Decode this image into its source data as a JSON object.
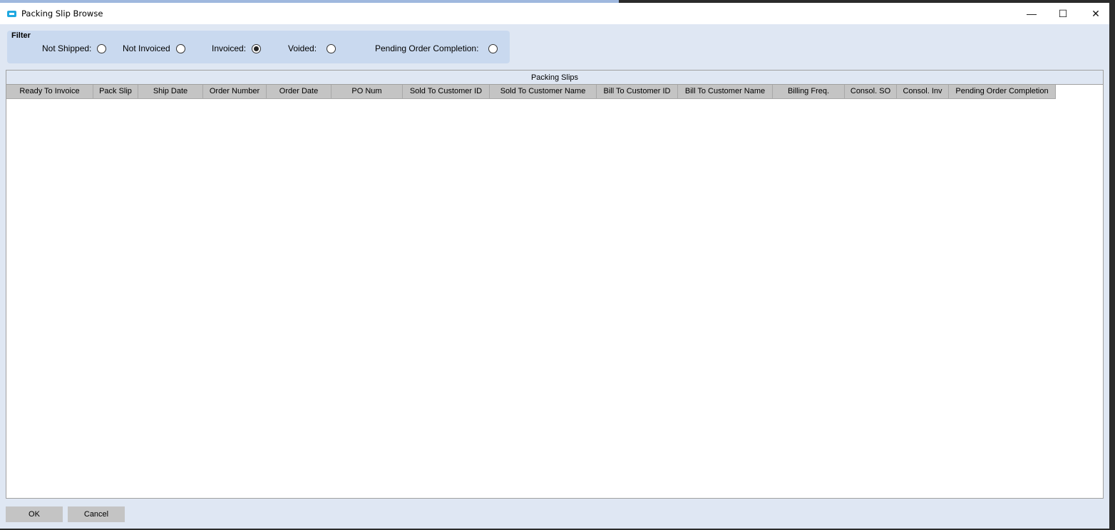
{
  "window": {
    "title": "Packing Slip Browse",
    "minimize": "—",
    "maximize": "☐",
    "close": "✕"
  },
  "filter": {
    "label": "Filter",
    "options": [
      {
        "label": "Not Shipped:",
        "checked": false
      },
      {
        "label": "Not Invoiced",
        "checked": false
      },
      {
        "label": "Invoiced:",
        "checked": true
      },
      {
        "label": "Voided:",
        "checked": false
      },
      {
        "label": "Pending Order Completion:",
        "checked": false
      }
    ]
  },
  "table": {
    "caption": "Packing Slips",
    "columns": [
      "Ready To Invoice",
      "Pack Slip",
      "Ship Date",
      "Order Number",
      "Order Date",
      "PO Num",
      "Sold To Customer ID",
      "Sold To Customer Name",
      "Bill To Customer ID",
      "Bill To Customer Name",
      "Billing Freq.",
      "Consol. SO",
      "Consol. Inv",
      "Pending Order Completion"
    ],
    "rows": []
  },
  "buttons": {
    "ok": "OK",
    "cancel": "Cancel"
  }
}
